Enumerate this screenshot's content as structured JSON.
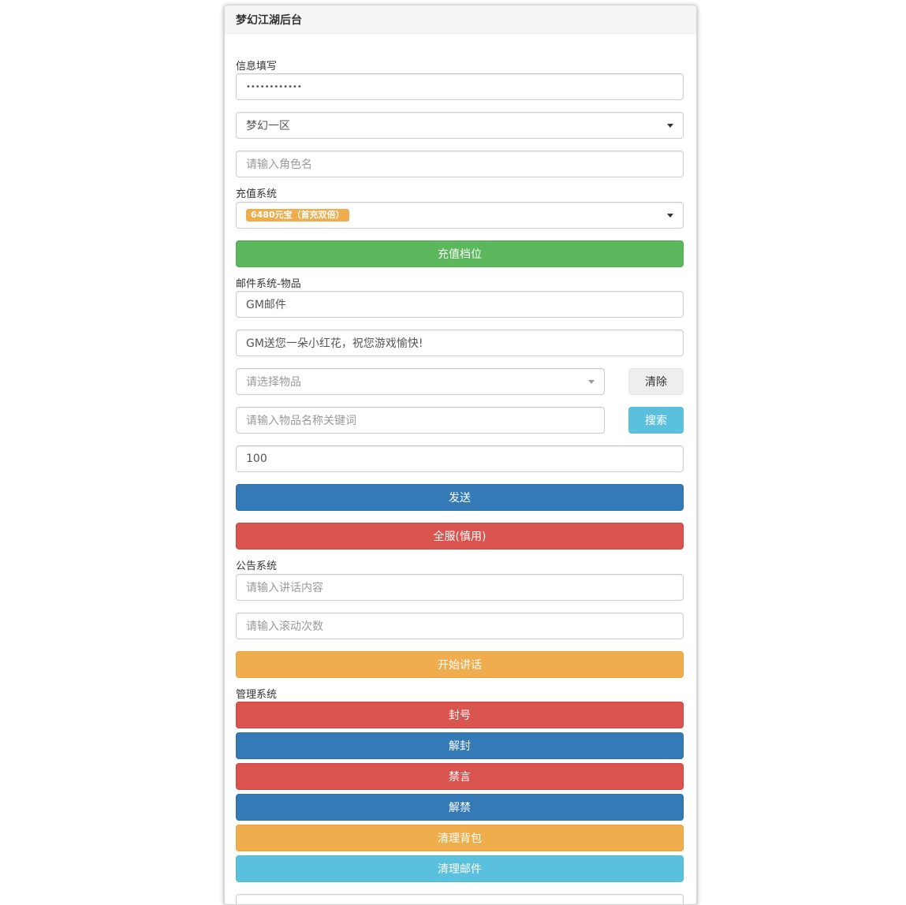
{
  "header": {
    "title": "梦幻江湖后台"
  },
  "info": {
    "label": "信息填写",
    "password_mask": "••••••••••••",
    "server_selected": "梦幻一区",
    "role_placeholder": "请输入角色名"
  },
  "recharge": {
    "label": "充值系统",
    "selected_tag": "6480元宝（首充双倍）",
    "button": "充值档位"
  },
  "mail": {
    "label": "邮件系统-物品",
    "title_value": "GM邮件",
    "content_value": "GM送您一朵小红花，祝您游戏愉快!",
    "item_select_placeholder": "请选择物品",
    "clear_button": "清除",
    "search_placeholder": "请输入物品名称关键词",
    "search_button": "搜索",
    "quantity_value": "100",
    "send_button": "发送",
    "all_server_button": "全服(慎用)"
  },
  "notice": {
    "label": "公告系统",
    "content_placeholder": "请输入讲话内容",
    "count_placeholder": "请输入滚动次数",
    "start_button": "开始讲话"
  },
  "manage": {
    "label": "管理系统",
    "ban": "封号",
    "unban": "解封",
    "mute": "禁言",
    "unmute": "解禁",
    "clear_bag": "清理背包",
    "clear_mail": "清理邮件"
  },
  "colors": {
    "success": "#5cb85c",
    "primary": "#337ab7",
    "danger": "#d9534f",
    "warning": "#f0ad4e",
    "info": "#5bc0de"
  }
}
